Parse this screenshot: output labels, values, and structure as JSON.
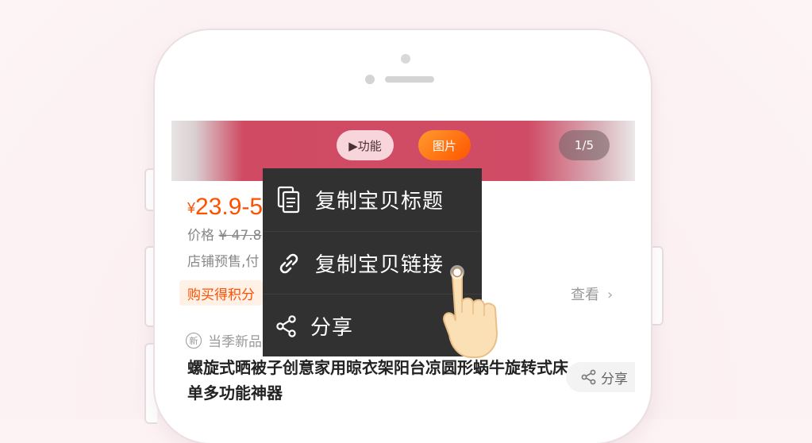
{
  "hero": {
    "func_label": "▶功能",
    "pic_label": "图片",
    "counter": "1/5"
  },
  "product": {
    "currency": "¥",
    "price": "23.9-5",
    "orig_label": "价格",
    "orig_price": "¥ 47.8",
    "presale": "店铺预售,付",
    "points": "购买得积分",
    "view": "查看",
    "tag_icon": "新",
    "tag": "当季新品",
    "title": "螺旋式晒被子创意家用晾衣架阳台凉圆形蜗牛旋转式床单多功能神器",
    "share": "分享"
  },
  "menu": {
    "items": [
      {
        "label": "复制宝贝标题",
        "icon": "copy-document-icon"
      },
      {
        "label": "复制宝贝链接",
        "icon": "link-icon"
      },
      {
        "label": "分享",
        "icon": "share-icon"
      }
    ]
  },
  "colors": {
    "accent": "#ff5000",
    "menu_bg": "#313131",
    "background": "#fdf2f4"
  }
}
